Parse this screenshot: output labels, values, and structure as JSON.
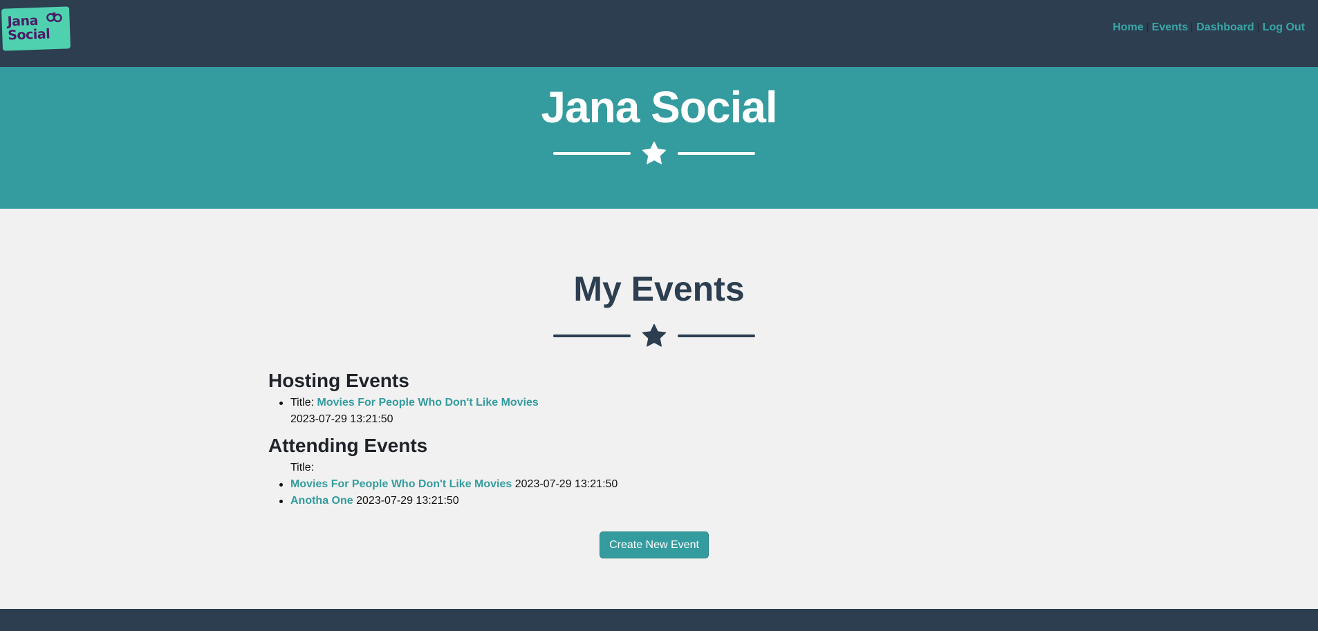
{
  "brand": {
    "logo_line1": "Jana",
    "logo_line2": "Social"
  },
  "nav": {
    "items": [
      {
        "label": "Home"
      },
      {
        "label": "Events"
      },
      {
        "label": "Dashboard"
      },
      {
        "label": "Log Out"
      }
    ]
  },
  "masthead": {
    "title": "Jana Social",
    "divider_icon": "star-icon"
  },
  "main": {
    "title": "My Events",
    "divider_icon": "star-icon",
    "hosting": {
      "heading": "Hosting Events",
      "title_prefix": "Title:",
      "events": [
        {
          "name": "Movies For People Who Don't Like Movies",
          "datetime": "2023-07-29 13:21:50"
        }
      ]
    },
    "attending": {
      "heading": "Attending Events",
      "title_prefix": "Title:",
      "events": [
        {
          "name": "Movies For People Who Don't Like Movies",
          "datetime": "2023-07-29 13:21:50"
        },
        {
          "name": "Anotha One",
          "datetime": "2023-07-29 13:21:50"
        }
      ]
    },
    "create_button": "Create New Event"
  },
  "colors": {
    "navbar": "#2c3e50",
    "accent": "#349c9f",
    "link": "#3aa6a6",
    "logo_bg": "#4fd1b0",
    "background": "#f1f1f1"
  }
}
